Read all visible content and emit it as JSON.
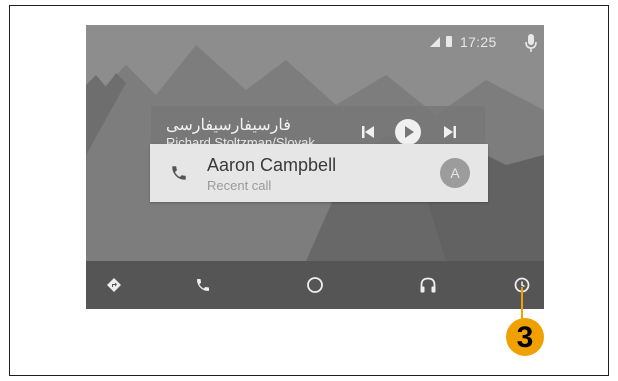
{
  "status_bar": {
    "time": "17:25",
    "icons": [
      "signal-icon",
      "battery-icon",
      "mic-icon"
    ]
  },
  "media": {
    "title": "فارسیفارسیفارسی",
    "subtitle": "Richard Stoltzman/Slovak ...",
    "controls": [
      "skip-previous-icon",
      "play-icon",
      "skip-next-icon"
    ]
  },
  "recent_call": {
    "name": "Aaron Campbell",
    "subtitle": "Recent call",
    "avatar_letter": "A"
  },
  "nav_bar": {
    "items": [
      "navigation-icon",
      "phone-icon",
      "home-icon",
      "headphones-icon",
      "recents-icon"
    ]
  },
  "callout": {
    "label": "3",
    "color": "#f0a000"
  },
  "colors": {
    "screen_bg": "#8a8a8a",
    "nav_bg": "#555555",
    "card_bg": "#e6e6e6"
  }
}
